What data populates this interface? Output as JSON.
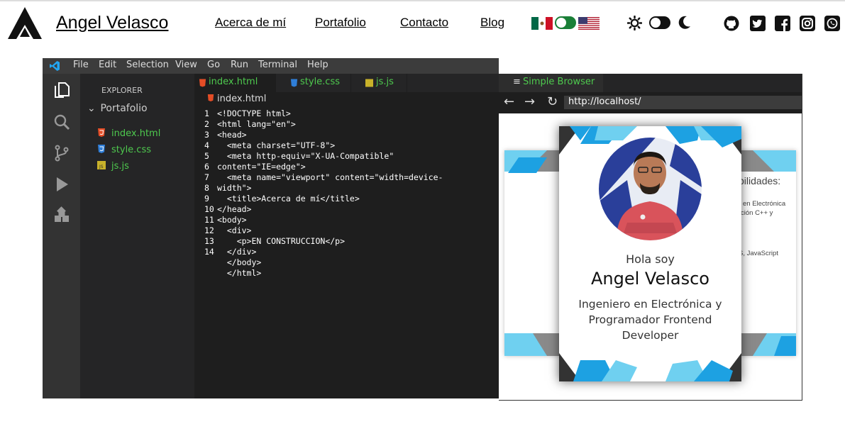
{
  "header": {
    "site_name": "Angel Velasco",
    "nav": [
      {
        "label": "Acerca de mí"
      },
      {
        "label": "Portafolio"
      },
      {
        "label": "Contacto"
      },
      {
        "label": "Blog"
      }
    ],
    "language_toggle": {
      "left_flag": "mexico-flag-icon",
      "right_flag": "usa-flag-icon",
      "accent": "#1a7f37"
    },
    "theme_toggle": {
      "left_icon": "sun-icon",
      "right_icon": "moon-icon"
    },
    "social_icons": [
      "github-icon",
      "twitter-icon",
      "facebook-icon",
      "instagram-icon",
      "whatsapp-icon"
    ]
  },
  "vscode": {
    "menu": [
      "File",
      "Edit",
      "Selection",
      "View",
      "Go",
      "Run",
      "Terminal",
      "Help"
    ],
    "explorer": {
      "title": "EXPLORER",
      "folder": "Portafolio",
      "files": [
        {
          "name": "index.html",
          "color": "#4ec94e",
          "icon": "html5-icon"
        },
        {
          "name": "style.css",
          "color": "#4ec94e",
          "icon": "css3-icon"
        },
        {
          "name": "js.js",
          "color": "#4ec94e",
          "icon": "javascript-icon"
        }
      ]
    },
    "tabs": [
      {
        "label": "index.html",
        "icon": "html5-icon"
      },
      {
        "label": "style.css",
        "icon": "css3-icon"
      },
      {
        "label": "js.js",
        "icon": "javascript-icon"
      }
    ],
    "breadcrumb": "index.html",
    "code_lines": [
      {
        "n": "1",
        "t": "<!DOCTYPE html>"
      },
      {
        "n": "2",
        "t": "<html lang=\"en\">"
      },
      {
        "n": "3",
        "t": "<head>"
      },
      {
        "n": "4",
        "t": "  <meta charset=\"UTF-8\">"
      },
      {
        "n": "5",
        "t": "  <meta http-equiv=\"X-UA-Compatible\""
      },
      {
        "n": "6",
        "t": "content=\"IE=edge\">"
      },
      {
        "n": "7",
        "t": "  <meta name=\"viewport\" content=\"width=device-"
      },
      {
        "n": "8",
        "t": "width\">"
      },
      {
        "n": "9",
        "t": "  <title>Acerca de mí</title>"
      },
      {
        "n": "10",
        "t": "</head>"
      },
      {
        "n": "11",
        "t": "<body>"
      },
      {
        "n": "12",
        "t": "  <div>"
      },
      {
        "n": "13",
        "t": "    <p>EN CONSTRUCCION</p>"
      },
      {
        "n": "14",
        "t": "  </div>"
      },
      {
        "n": "",
        "t": "  </body>"
      },
      {
        "n": "",
        "t": "  </html>"
      }
    ]
  },
  "browser": {
    "tab_label": "Simple Browser",
    "url": "http://localhost/",
    "card": {
      "greeting": "Hola soy",
      "name": "Angel Velasco",
      "role": "Ingeniero en Electrónica y Programador Frontend Developer"
    },
    "back_card": {
      "heading_fragment": "bilidades:",
      "line1": "en Electrónica",
      "line2": "ción C++ y",
      "line3": "S, JavaScript"
    },
    "accent_color": "#1da1e2"
  }
}
